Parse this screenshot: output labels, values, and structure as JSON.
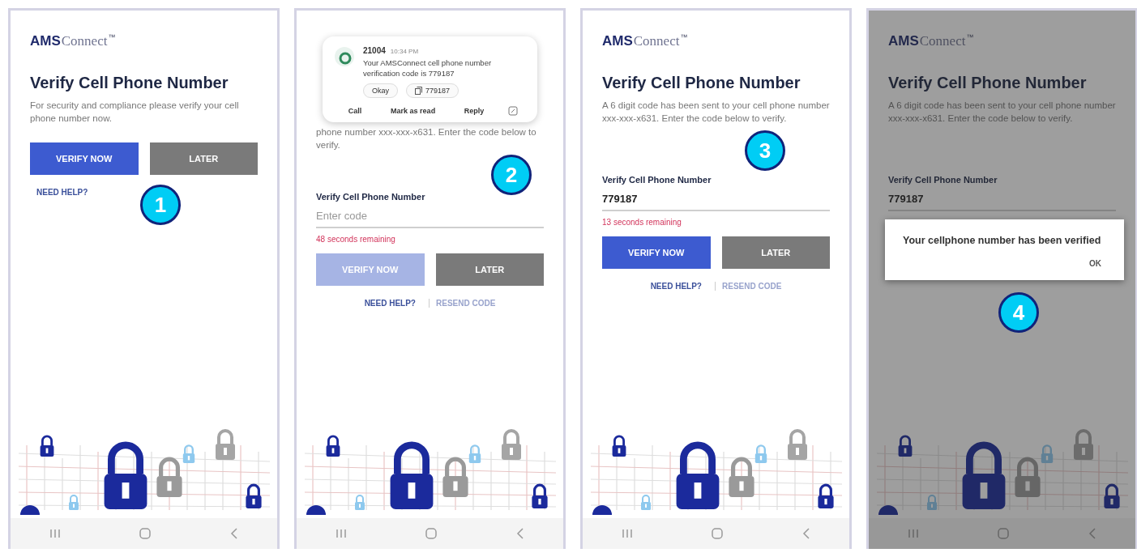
{
  "panels": [
    {
      "step": "1",
      "dimmed": false,
      "logo": {
        "prefix": "AMS",
        "suffix": "Connect",
        "mark": "™"
      },
      "title": "Verify Cell Phone Number",
      "description": "For security and compliance please verify your cell phone number now.",
      "buttons": [
        {
          "label": "VERIFY NOW",
          "kind": "primary",
          "disabled": false
        },
        {
          "label": "LATER",
          "kind": "secondary",
          "disabled": false
        }
      ],
      "links": [
        {
          "label": "NEED HELP?",
          "disabled": false
        }
      ]
    },
    {
      "step": "2",
      "dimmed": false,
      "notification": {
        "sender": "21004",
        "time": "10:34 PM",
        "message": "Your AMSConnect cell phone number verification code is 779187",
        "chips": [
          {
            "label": "Okay",
            "kind": "plain"
          },
          {
            "label": "779187",
            "kind": "copy"
          }
        ],
        "actions": [
          "Call",
          "Mark as read",
          "Reply"
        ]
      },
      "description": "phone number xxx-xxx-x631. Enter the code below to verify.",
      "field": {
        "label": "Verify Cell Phone Number",
        "placeholder": "Enter code"
      },
      "timer": "48 seconds remaining",
      "buttons": [
        {
          "label": "VERIFY NOW",
          "kind": "primary",
          "disabled": true
        },
        {
          "label": "LATER",
          "kind": "secondary",
          "disabled": false
        }
      ],
      "links": [
        {
          "label": "NEED HELP?",
          "disabled": false
        },
        {
          "label": "RESEND CODE",
          "disabled": true
        }
      ]
    },
    {
      "step": "3",
      "dimmed": false,
      "logo": {
        "prefix": "AMS",
        "suffix": "Connect",
        "mark": "™"
      },
      "title": "Verify Cell Phone Number",
      "description": "A 6 digit code has been sent to your cell phone number xxx-xxx-x631. Enter the code below to verify.",
      "field": {
        "label": "Verify Cell Phone Number",
        "value": "779187"
      },
      "timer": "13 seconds remaining",
      "buttons": [
        {
          "label": "VERIFY NOW",
          "kind": "primary",
          "disabled": false
        },
        {
          "label": "LATER",
          "kind": "secondary",
          "disabled": false
        }
      ],
      "links": [
        {
          "label": "NEED HELP?",
          "disabled": false
        },
        {
          "label": "RESEND CODE",
          "disabled": true
        }
      ]
    },
    {
      "step": "4",
      "dimmed": true,
      "logo": {
        "prefix": "AMS",
        "suffix": "Connect",
        "mark": "™"
      },
      "title": "Verify Cell Phone Number",
      "description": "A 6 digit code has been sent to your cell phone number xxx-xxx-x631. Enter the code below to verify.",
      "field": {
        "label": "Verify Cell Phone Number",
        "value": "779187"
      },
      "dialog": {
        "message": "Your cellphone number has been verified",
        "button": "OK"
      }
    }
  ]
}
